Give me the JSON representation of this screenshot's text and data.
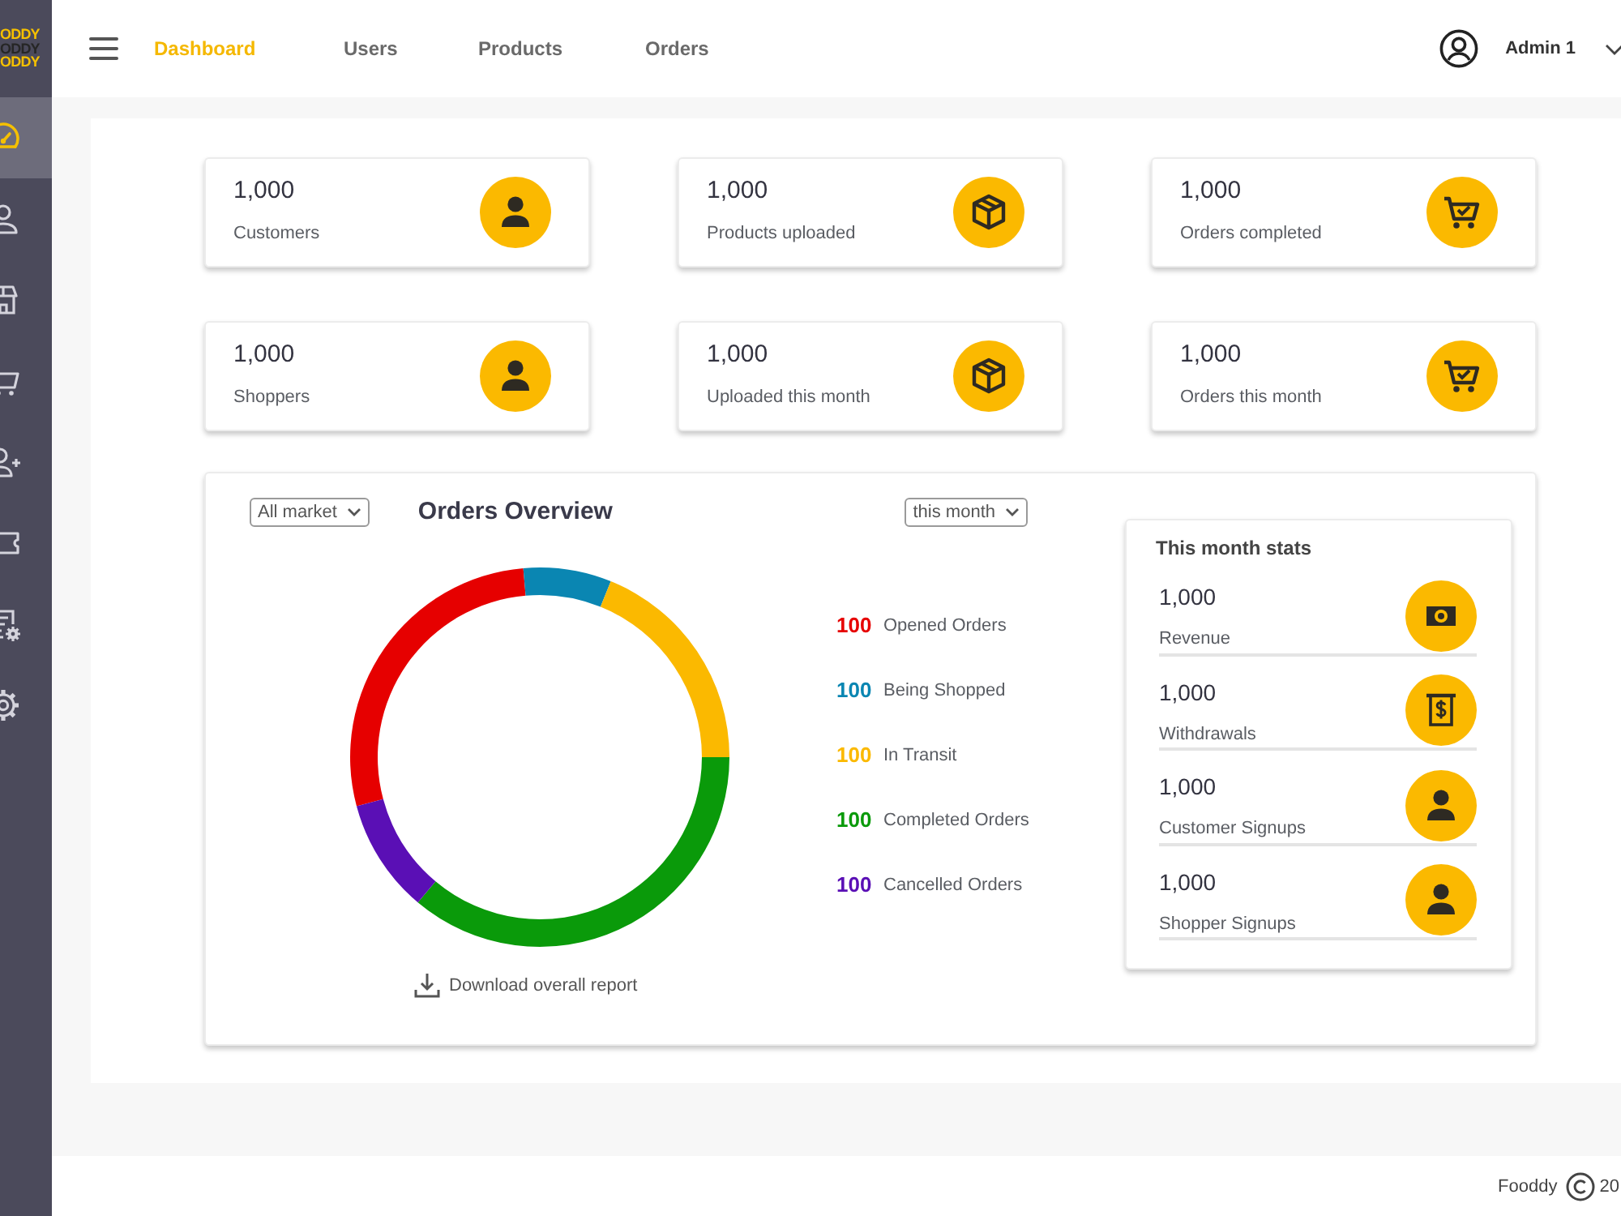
{
  "sidebar": {
    "logo": [
      "ODDY",
      "ODDY",
      "ODDY"
    ],
    "items": [
      {
        "kind": "dashboard",
        "selected": true
      },
      {
        "kind": "users",
        "selected": false
      },
      {
        "kind": "stores",
        "selected": false
      },
      {
        "kind": "orders",
        "selected": false
      },
      {
        "kind": "signups",
        "selected": false
      },
      {
        "kind": "vouchers",
        "selected": false
      },
      {
        "kind": "billing",
        "selected": false
      },
      {
        "kind": "settings",
        "selected": false
      }
    ]
  },
  "nav": [
    {
      "label": "Dashboard",
      "selected": true
    },
    {
      "label": "Users",
      "selected": false
    },
    {
      "label": "Products",
      "selected": false
    },
    {
      "label": "Orders",
      "selected": false
    }
  ],
  "user": {
    "name": "Admin 1"
  },
  "stat_cards": [
    {
      "value": "1,000",
      "label": "Customers",
      "kind": "users"
    },
    {
      "value": "1,000",
      "label": "Products uploaded",
      "kind": "products"
    },
    {
      "value": "1,000",
      "label": "Orders completed",
      "kind": "orders"
    },
    {
      "value": "1,000",
      "label": "Shoppers",
      "kind": "users"
    },
    {
      "value": "1,000",
      "label": "Uploaded this month",
      "kind": "products"
    },
    {
      "value": "1,000",
      "label": "Orders this month",
      "kind": "orders"
    }
  ],
  "orders_overview": {
    "market_filter": "All market",
    "title": "Orders Overview",
    "period_filter": "this month",
    "legend": [
      {
        "count": "100",
        "label": "Opened Orders",
        "color": "#e60000"
      },
      {
        "count": "100",
        "label": "Being Shopped",
        "color": "#0a86b2"
      },
      {
        "count": "100",
        "label": "In Transit",
        "color": "#fbb900"
      },
      {
        "count": "100",
        "label": "Completed Orders",
        "color": "#0a9a0a"
      },
      {
        "count": "100",
        "label": "Cancelled Orders",
        "color": "#5a0fb5"
      }
    ],
    "download": "Download overall report"
  },
  "month_stats": {
    "title": "This month stats",
    "items": [
      {
        "value": "1,000",
        "label": "Revenue",
        "kind": "revenue"
      },
      {
        "value": "1,000",
        "label": "Withdrawals",
        "kind": "withdrawals"
      },
      {
        "value": "1,000",
        "label": "Customer Signups",
        "kind": "signups"
      },
      {
        "value": "1,000",
        "label": "Shopper Signups",
        "kind": "signups"
      }
    ]
  },
  "footer": {
    "brand": "Fooddy",
    "year": "20"
  }
}
